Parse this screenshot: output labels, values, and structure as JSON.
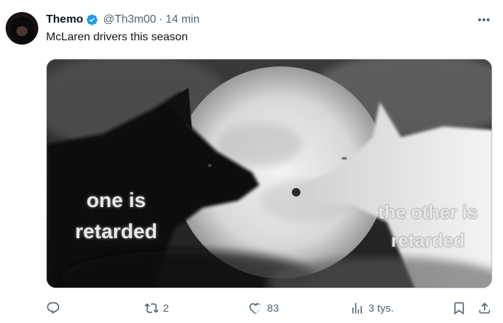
{
  "author": {
    "name": "Themo",
    "handle": "@Th3m00",
    "separator": "·",
    "time": "14 min"
  },
  "tweet": {
    "text": "McLaren drivers this season"
  },
  "media": {
    "caption_left_line1": "one is",
    "caption_left_line2": "retarded",
    "caption_right_line1": "the other is",
    "caption_right_line2": "retarded"
  },
  "actions": {
    "replies": "",
    "reposts": "2",
    "likes": "83",
    "views": "3 tys."
  },
  "colors": {
    "verified": "#1d9bf0",
    "muted": "#536471",
    "text": "#0f1419"
  },
  "icons": [
    "verified-badge-icon",
    "more-icon",
    "reply-icon",
    "repost-icon",
    "like-icon",
    "views-icon",
    "bookmark-icon",
    "share-icon"
  ]
}
